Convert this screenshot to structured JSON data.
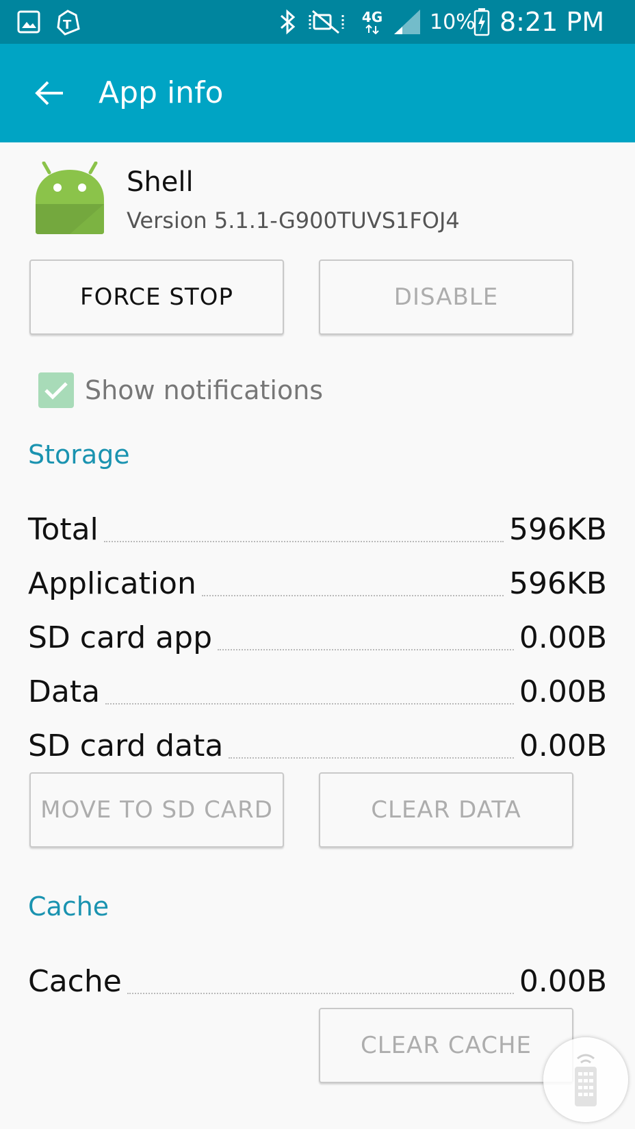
{
  "status_bar": {
    "battery_text": "10%",
    "time": "8:21 PM",
    "network": "4G",
    "icons": [
      "gallery-icon",
      "tmobile-icon",
      "bluetooth-icon",
      "mute-icon",
      "network-4g-icon",
      "signal-icon",
      "battery-charging-icon"
    ]
  },
  "app_bar": {
    "title": "App info",
    "back_icon": "back-arrow-icon"
  },
  "app": {
    "name": "Shell",
    "version": "Version 5.1.1-G900TUVS1FOJ4",
    "icon": "android-icon"
  },
  "actions": {
    "force_stop": "FORCE STOP",
    "disable": "DISABLE"
  },
  "notifications": {
    "label": "Show notifications",
    "checked": true
  },
  "storage": {
    "header": "Storage",
    "rows": [
      {
        "label": "Total",
        "value": "596KB"
      },
      {
        "label": "Application",
        "value": "596KB"
      },
      {
        "label": "SD card app",
        "value": "0.00B"
      },
      {
        "label": "Data",
        "value": "0.00B"
      },
      {
        "label": "SD card data",
        "value": "0.00B"
      }
    ],
    "move_to_sd": "MOVE TO SD CARD",
    "clear_data": "CLEAR DATA"
  },
  "cache": {
    "header": "Cache",
    "rows": [
      {
        "label": "Cache",
        "value": "0.00B"
      }
    ],
    "clear_cache": "CLEAR CACHE"
  },
  "colors": {
    "status_bar": "#00859e",
    "app_bar": "#00a4c4",
    "section_header": "#1a93b0",
    "checkbox": "#a8dbb8",
    "android_green": "#8bc34a"
  },
  "floating_button": {
    "icon": "remote-control-icon"
  }
}
